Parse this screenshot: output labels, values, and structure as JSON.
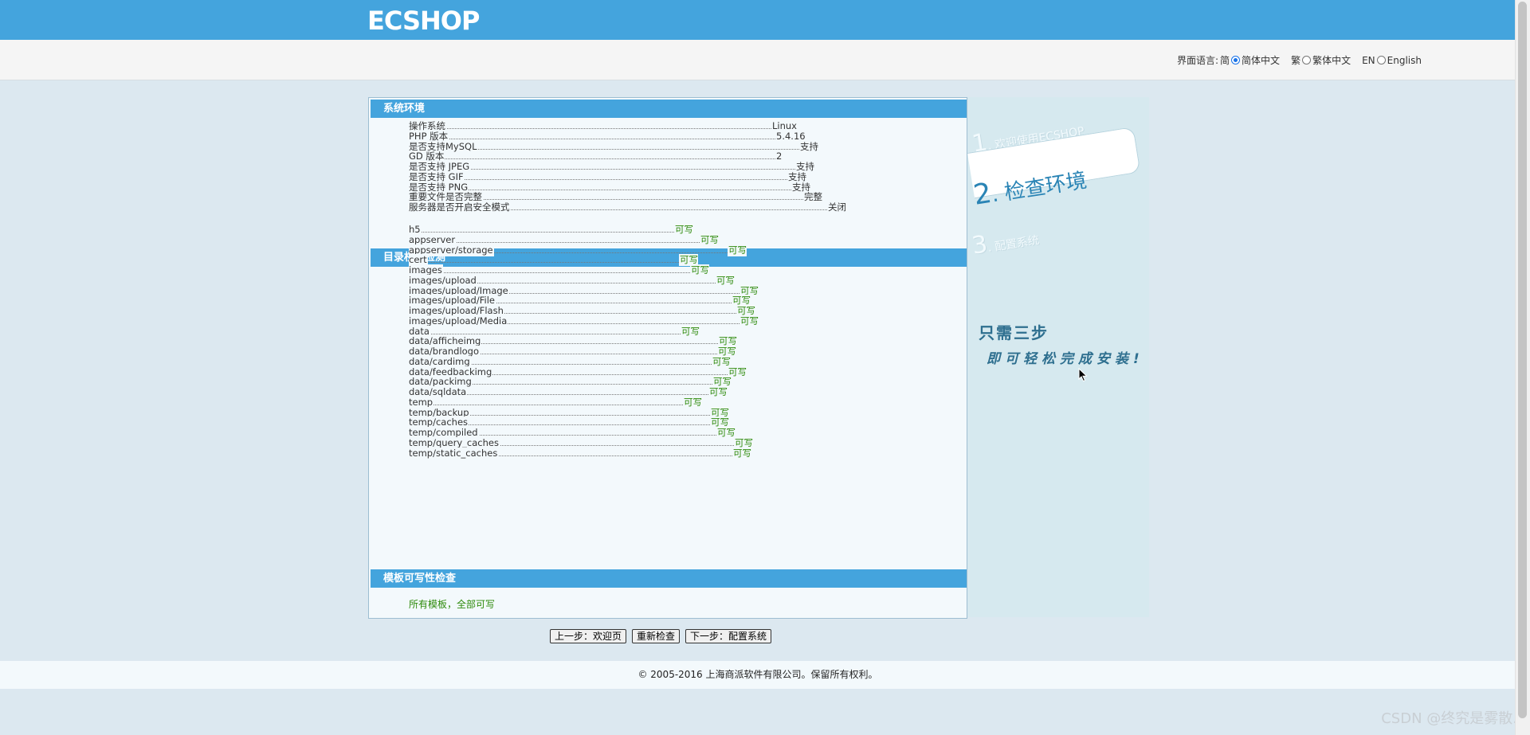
{
  "header": {
    "logo_text": "ECSHOP"
  },
  "language": {
    "label": "界面语言:",
    "options": [
      {
        "prefix": "简",
        "label": "简体中文",
        "selected": true
      },
      {
        "prefix": "繁",
        "label": "繁体中文",
        "selected": false
      },
      {
        "prefix": "EN",
        "label": "English",
        "selected": false
      }
    ]
  },
  "system_env": {
    "title": "系统环境",
    "rows": [
      {
        "label": "操作系统",
        "value": "Linux"
      },
      {
        "label": "PHP 版本",
        "value": "5.4.16"
      },
      {
        "label": "是否支持MySQL",
        "value": "支持"
      },
      {
        "label": "GD 版本",
        "value": "2"
      },
      {
        "label": "是否支持 JPEG",
        "value": "支持"
      },
      {
        "label": "是否支持 GIF",
        "value": "支持"
      },
      {
        "label": "是否支持 PNG",
        "value": "支持"
      },
      {
        "label": "重要文件是否完整",
        "value": "完整"
      },
      {
        "label": "服务器是否开启安全模式",
        "value": "关闭"
      }
    ]
  },
  "dir_perms": {
    "title": "目录权限检测",
    "rows": [
      {
        "label": "h5",
        "value": "可写"
      },
      {
        "label": "appserver",
        "value": "可写"
      },
      {
        "label": "appserver/storage",
        "value": "可写"
      },
      {
        "label": "cert",
        "value": "可写"
      },
      {
        "label": "images",
        "value": "可写"
      },
      {
        "label": "images/upload",
        "value": "可写"
      },
      {
        "label": "images/upload/Image",
        "value": "可写"
      },
      {
        "label": "images/upload/File",
        "value": "可写"
      },
      {
        "label": "images/upload/Flash",
        "value": "可写"
      },
      {
        "label": "images/upload/Media",
        "value": "可写"
      },
      {
        "label": "data",
        "value": "可写"
      },
      {
        "label": "data/afficheimg",
        "value": "可写"
      },
      {
        "label": "data/brandlogo",
        "value": "可写"
      },
      {
        "label": "data/cardimg",
        "value": "可写"
      },
      {
        "label": "data/feedbackimg",
        "value": "可写"
      },
      {
        "label": "data/packimg",
        "value": "可写"
      },
      {
        "label": "data/sqldata",
        "value": "可写"
      },
      {
        "label": "temp",
        "value": "可写"
      },
      {
        "label": "temp/backup",
        "value": "可写"
      },
      {
        "label": "temp/caches",
        "value": "可写"
      },
      {
        "label": "temp/compiled",
        "value": "可写"
      },
      {
        "label": "temp/query_caches",
        "value": "可写"
      },
      {
        "label": "temp/static_caches",
        "value": "可写"
      }
    ]
  },
  "template_check": {
    "title": "模板可写性检查",
    "message": "所有模板，全部可写"
  },
  "steps": {
    "step1_num": "1",
    "step1_label": ". 欢迎使用ECSHOP",
    "step2_num": "2",
    "step2_label": ". 检查环境",
    "step3_num": "3",
    "step3_label": ". 配置系统",
    "slogan_line1": "只需三步",
    "slogan_line2": "即可轻松完成安装!"
  },
  "buttons": {
    "prev": "上一步：欢迎页",
    "recheck": "重新检查",
    "next": "下一步：配置系统"
  },
  "footer": {
    "copyright": "© 2005-2016 上海商派软件有限公司。保留所有权利。"
  },
  "watermark": "CSDN @终究是雾散."
}
